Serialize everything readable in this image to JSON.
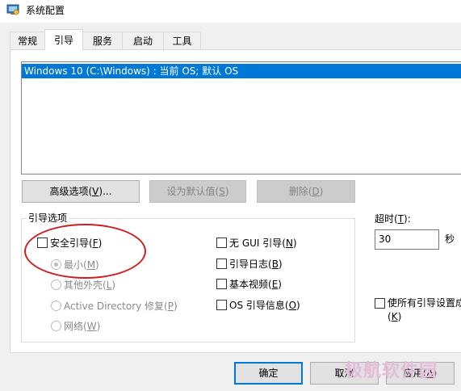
{
  "window": {
    "title": "系统配置"
  },
  "tabs": [
    {
      "label": "常规"
    },
    {
      "label": "引导"
    },
    {
      "label": "服务"
    },
    {
      "label": "启动"
    },
    {
      "label": "工具"
    }
  ],
  "os_list": {
    "entries": [
      "Windows 10 (C:\\Windows) : 当前 OS; 默认 OS"
    ]
  },
  "buttons": {
    "advanced": {
      "pre": "高级选项(",
      "key": "V",
      "post": ")..."
    },
    "set_default": {
      "pre": "设为默认值(",
      "key": "S",
      "post": ")"
    },
    "delete": {
      "pre": "删除(",
      "key": "D",
      "post": ")"
    }
  },
  "boot_options": {
    "group_label": "引导选项",
    "safe_boot": {
      "pre": "安全引导(",
      "key": "F",
      "post": ")"
    },
    "minimal": {
      "pre": "最小(",
      "key": "M",
      "post": ")"
    },
    "alt_shell": {
      "pre": "其他外壳(",
      "key": "L",
      "post": ")"
    },
    "ad_repair": {
      "pre": "Active Directory 修复(",
      "key": "P",
      "post": ")"
    },
    "network": {
      "pre": "网络(",
      "key": "W",
      "post": ")"
    },
    "no_gui": {
      "pre": "无 GUI 引导(",
      "key": "N",
      "post": ")"
    },
    "boot_log": {
      "pre": "引导日志(",
      "key": "B",
      "post": ")"
    },
    "base_video": {
      "pre": "基本视频(",
      "key": "E",
      "post": ")"
    },
    "os_info": {
      "pre": "OS 引导信息(",
      "key": "O",
      "post": ")"
    }
  },
  "timeout": {
    "label_pre": "超时(",
    "label_key": "T",
    "label_post": "):",
    "value": "30",
    "unit": "秒"
  },
  "make_permanent": {
    "line1": "使所有引导设置成",
    "line2_pre": "(",
    "line2_key": "K",
    "line2_post": ")"
  },
  "footer": {
    "ok": "确定",
    "cancel": "取消",
    "apply": {
      "pre": "应用(",
      "key": "A",
      "post": ")"
    }
  },
  "watermark": "极航软件园",
  "colors": {
    "selection": "#0078d7",
    "annotation_circle": "#d01e1e",
    "watermark": "#e4bcd8"
  },
  "icons": {
    "window": "system-config-icon"
  }
}
